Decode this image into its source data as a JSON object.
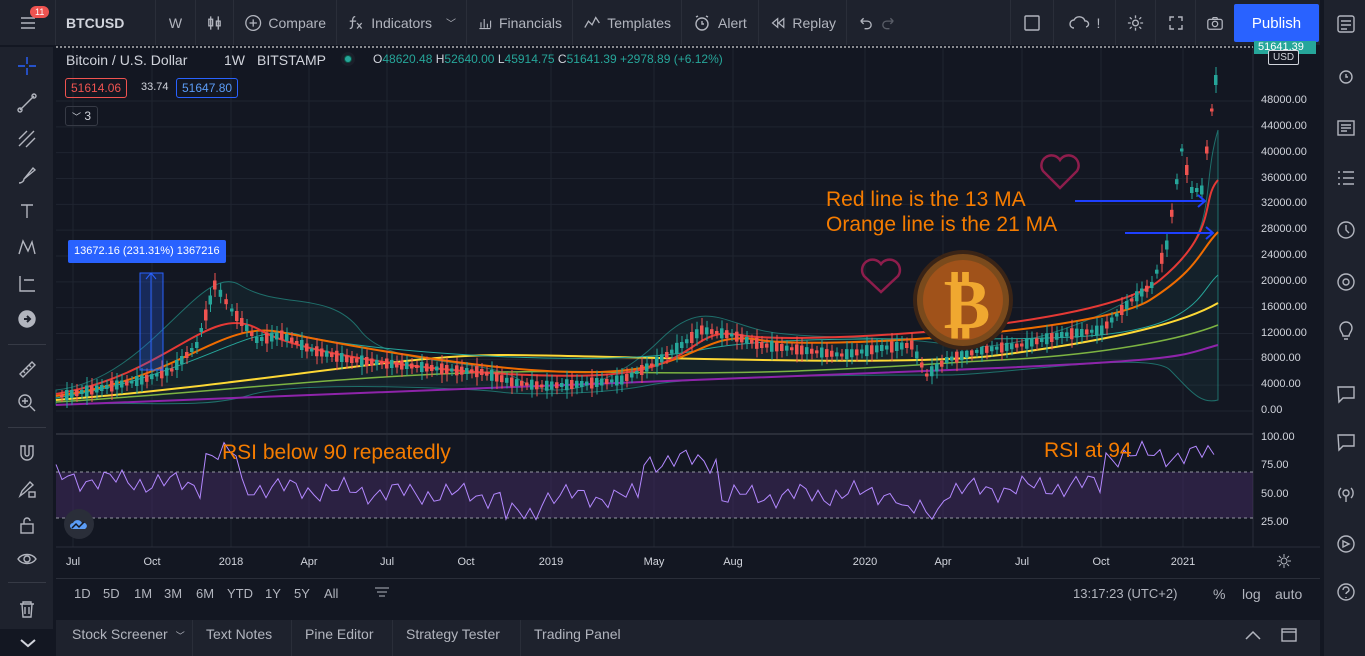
{
  "topbar": {
    "symbol": "BTCUSD",
    "interval": "W",
    "compare": "Compare",
    "indicators": "Indicators",
    "financials": "Financials",
    "templates": "Templates",
    "alert": "Alert",
    "replay": "Replay",
    "publish": "Publish",
    "layout_suffix": "!",
    "notif_count": "11"
  },
  "legend": {
    "title": "Bitcoin / U.S. Dollar",
    "tf": "1W",
    "exch": "BITSTAMP",
    "o_label": "O",
    "o": "48620.48",
    "h_label": "H",
    "h": "52640.00",
    "l_label": "L",
    "l": "45914.75",
    "c_label": "C",
    "c": "51641.39",
    "chg": "+2978.89 (+6.12%)",
    "bid": "51614.06",
    "spread": "33.74",
    "ask": "51647.80",
    "indicators_count": "3"
  },
  "measure": {
    "label": "13672.16 (231.31%) 1367216"
  },
  "price_axis": [
    "48000.00",
    "44000.00",
    "40000.00",
    "36000.00",
    "32000.00",
    "28000.00",
    "24000.00",
    "20000.00",
    "16000.00",
    "12000.00",
    "8000.00",
    "4000.00",
    "0.00"
  ],
  "price_badge": "51641.39",
  "currency": "USD",
  "rsi_axis": [
    "100.00",
    "75.00",
    "50.00",
    "25.00"
  ],
  "time_axis": [
    "Jul",
    "Oct",
    "2018",
    "Apr",
    "Jul",
    "Oct",
    "2019",
    "May",
    "Aug",
    "2020",
    "Apr",
    "Jul",
    "Oct",
    "2021"
  ],
  "annotations": {
    "red": "Red line is the 13 MA",
    "orange": "Orange line is the 21 MA",
    "rsi_below": "RSI below 90 repeatedly",
    "rsi_at": "RSI at 94"
  },
  "ranges": [
    "1D",
    "5D",
    "1M",
    "3M",
    "6M",
    "YTD",
    "1Y",
    "5Y",
    "All"
  ],
  "clock": "13:17:23 (UTC+2)",
  "scale": {
    "pct": "%",
    "log": "log",
    "auto": "auto"
  },
  "bottom_tabs": [
    "Stock Screener",
    "Text Notes",
    "Pine Editor",
    "Strategy Tester",
    "Trading Panel"
  ],
  "colors": {
    "up": "#26a69a",
    "down": "#ef5350",
    "accent": "#2962ff",
    "annotation": "#f57c00",
    "ma13": "#e53935",
    "ma21": "#ef6c00"
  }
}
